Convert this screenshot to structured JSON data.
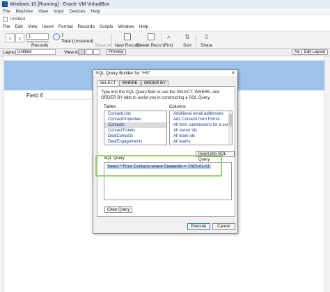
{
  "vbox": {
    "title": "Windows 10 [Running] - Oracle VM VirtualBox",
    "menu": [
      "File",
      "Machine",
      "View",
      "Input",
      "Devices",
      "Help"
    ]
  },
  "fm": {
    "doc_title": "Untitled",
    "menu": [
      "File",
      "Edit",
      "View",
      "Insert",
      "Format",
      "Records",
      "Scripts",
      "Window",
      "Help"
    ],
    "toolbar": {
      "prev": "‹",
      "next": "›",
      "record_value": "1",
      "records_label": "Records",
      "total_count": "7",
      "total_text": "Total (Unsorted)",
      "show_all": "Show All",
      "new_record": "New Record",
      "delete_record": "Delete Record",
      "find": "Find",
      "sort": "Sort",
      "share": "Share"
    },
    "layout_bar": {
      "layout_label": "Layout:",
      "layout_value": "Untitled",
      "view_as": "View As:",
      "preview": "Preview",
      "aa": "Aa",
      "edit_layout": "Edit Layout"
    },
    "content": {
      "field_label": "Field 6"
    }
  },
  "dialog": {
    "title": "SQL Query Builder for \"HS\"",
    "close": "✕",
    "tabs": [
      "SELECT",
      "WHERE",
      "ORDER BY"
    ],
    "instructions": "Type into the SQL Query field or use the SELECT, WHERE, and ORDER BY tabs to assist you in constructing a SQL Query.",
    "tables_label": "Tables",
    "columns_label": "Columns",
    "tables": [
      "ContactLists",
      "ContactProperties",
      "Contacts",
      "ContactTickets",
      "DealContacts",
      "DealEngagements"
    ],
    "selected_table": "Contacts",
    "columns": [
      "Additional email addresses",
      "Ads Consent from Forms",
      "All form submissions for a contact",
      "All owner ids",
      "All team ids",
      "All teams"
    ],
    "insert_btn": "Insert into SQL Query",
    "sql_label": "SQL Query",
    "sql_text": "Select * From Contacts where CreatedAt > '2023-01-01'",
    "clear_btn": "Clear Query",
    "execute_btn": "Execute",
    "cancel_btn": "Cancel"
  },
  "colors": {
    "header_band": "#9dc3e8",
    "highlight": "#9bd26a",
    "selection": "#b9d2ee"
  }
}
